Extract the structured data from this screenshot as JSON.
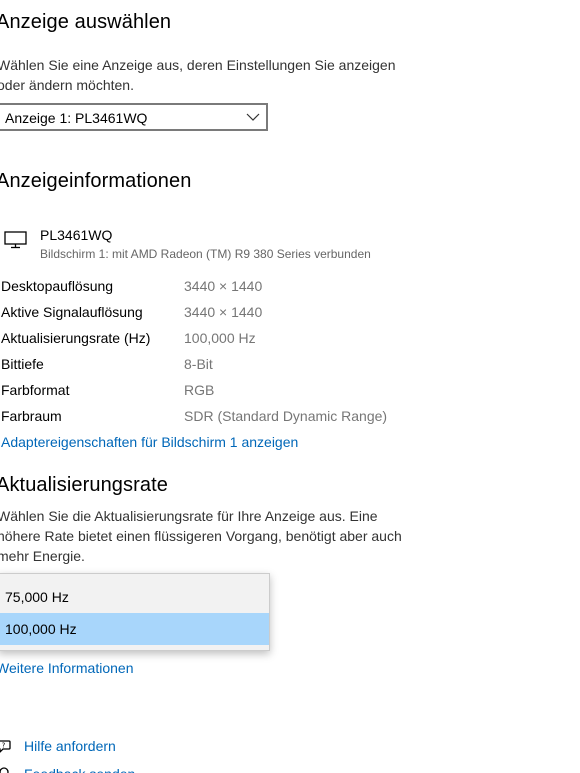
{
  "select_display": {
    "heading": "Anzeige auswählen",
    "description_line1": "Wählen Sie eine Anzeige aus, deren Einstellungen Sie anzeigen",
    "description_line2": "oder ändern möchten.",
    "dropdown_value": "Anzeige 1: PL3461WQ"
  },
  "display_info": {
    "heading": "Anzeigeinformationen",
    "monitor_name": "PL3461WQ",
    "monitor_subtitle": "Bildschirm 1: mit AMD Radeon (TM) R9 380 Series verbunden",
    "rows": [
      {
        "label": "Desktopauflösung",
        "value": "3440 × 1440"
      },
      {
        "label": "Aktive Signalauflösung",
        "value": "3440 × 1440"
      },
      {
        "label": "Aktualisierungsrate (Hz)",
        "value": "100,000 Hz"
      },
      {
        "label": "Bittiefe",
        "value": "8-Bit"
      },
      {
        "label": "Farbformat",
        "value": "RGB"
      },
      {
        "label": "Farbraum",
        "value": "SDR (Standard Dynamic Range)"
      }
    ],
    "adapter_link": "Adaptereigenschaften für Bildschirm 1 anzeigen"
  },
  "refresh_rate": {
    "heading": "Aktualisierungsrate",
    "description_line1": "Wählen Sie die Aktualisierungsrate für Ihre Anzeige aus. Eine",
    "description_line2": "höhere Rate bietet einen flüssigeren Vorgang, benötigt aber auch",
    "description_line3": "mehr Energie.",
    "options": [
      "75,000 Hz",
      "100,000 Hz"
    ],
    "selected_option": "100,000 Hz",
    "more_info_link": "Weitere Informationen"
  },
  "footer": {
    "help_link": "Hilfe anfordern",
    "feedback_link": "Feedback senden"
  },
  "colors": {
    "link": "#0067b8",
    "selected_option_bg": "#a8d6fb",
    "value_text": "#767676"
  },
  "icons": [
    "chevron-down-icon",
    "monitor-icon",
    "help-icon",
    "feedback-icon"
  ]
}
